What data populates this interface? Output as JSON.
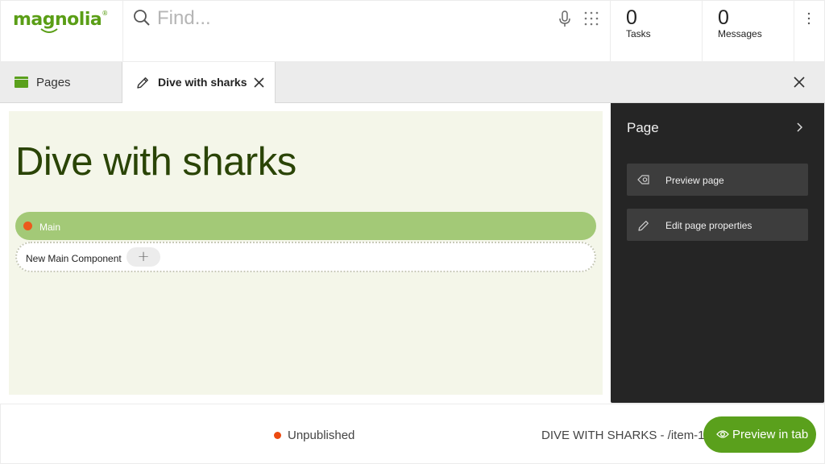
{
  "header": {
    "logo_text": "magnolia",
    "logo_mark": "®",
    "search": {
      "placeholder": "Find...",
      "value": "",
      "icons": [
        "search-icon",
        "microphone-icon",
        "apps-grid-icon"
      ]
    },
    "tasks": {
      "count": "0",
      "label": "Tasks"
    },
    "messages": {
      "count": "0",
      "label": "Messages"
    },
    "more_icon": "vertical-dots-icon"
  },
  "tabs": [
    {
      "label": "Pages",
      "icon": "pages-app-icon",
      "active": false
    },
    {
      "label": "Dive with sharks",
      "icon": "pencil-icon",
      "active": true,
      "closable": true
    }
  ],
  "editor": {
    "page_heading": "Dive with sharks",
    "area": {
      "label": "Main",
      "status_color": "#ec5a1c"
    },
    "new_component": {
      "label": "New Main Component",
      "add_symbol": "+"
    }
  },
  "side_panel": {
    "title": "Page",
    "actions": [
      {
        "label": "Preview page",
        "icon": "preview-icon"
      },
      {
        "label": "Edit page properties",
        "icon": "pencil-icon"
      }
    ]
  },
  "footer": {
    "status": "Unpublished",
    "status_color": "#ec4a10",
    "path": "DIVE WITH SHARKS - /item-1",
    "preview_button": "Preview in tab"
  },
  "colors": {
    "brand_green": "#5aa01c",
    "area_green": "#a3c977",
    "canvas_bg": "#f4f6e9",
    "panel_bg": "#252525",
    "heading": "#2a4406"
  }
}
